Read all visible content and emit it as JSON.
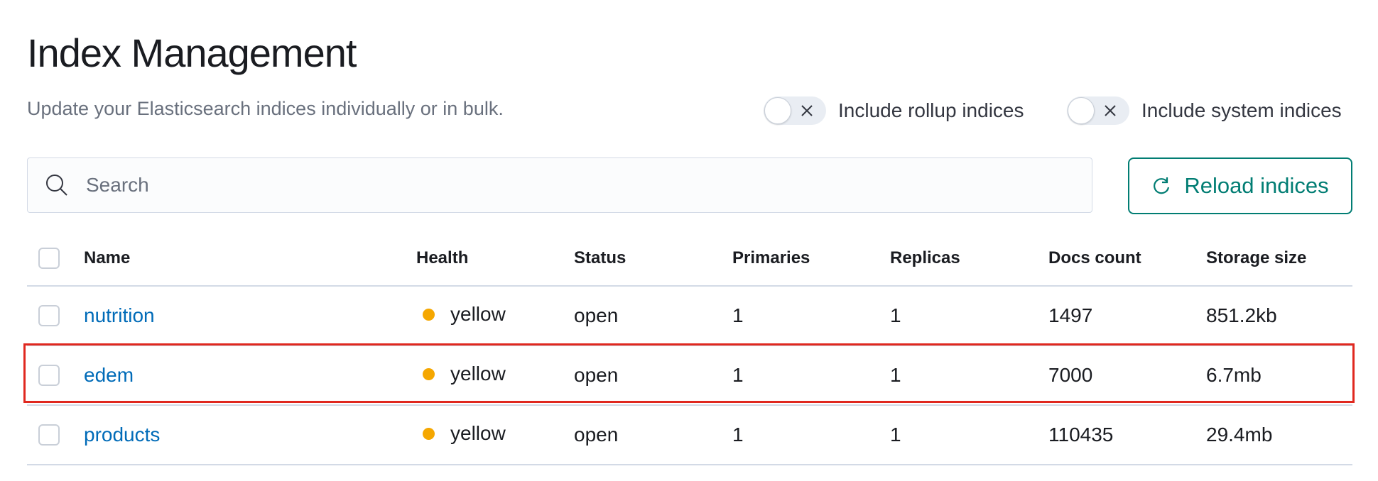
{
  "page": {
    "title": "Index Management",
    "subtitle": "Update your Elasticsearch indices individually or in bulk."
  },
  "toggles": {
    "rollup_label": "Include rollup indices",
    "system_label": "Include system indices"
  },
  "search": {
    "placeholder": "Search",
    "icon": "search-icon"
  },
  "reload_button": {
    "label": "Reload indices",
    "icon": "refresh-icon"
  },
  "colors": {
    "accent": "#017d73",
    "link": "#006bb8",
    "health_yellow": "#f5a700",
    "highlight": "#e0281f"
  },
  "table": {
    "columns": [
      "Name",
      "Health",
      "Status",
      "Primaries",
      "Replicas",
      "Docs count",
      "Storage size"
    ],
    "rows": [
      {
        "name": "nutrition",
        "health": "yellow",
        "status": "open",
        "primaries": "1",
        "replicas": "1",
        "docs_count": "1497",
        "storage_size": "851.2kb"
      },
      {
        "name": "edem",
        "health": "yellow",
        "status": "open",
        "primaries": "1",
        "replicas": "1",
        "docs_count": "7000",
        "storage_size": "6.7mb"
      },
      {
        "name": "products",
        "health": "yellow",
        "status": "open",
        "primaries": "1",
        "replicas": "1",
        "docs_count": "110435",
        "storage_size": "29.4mb"
      }
    ]
  }
}
